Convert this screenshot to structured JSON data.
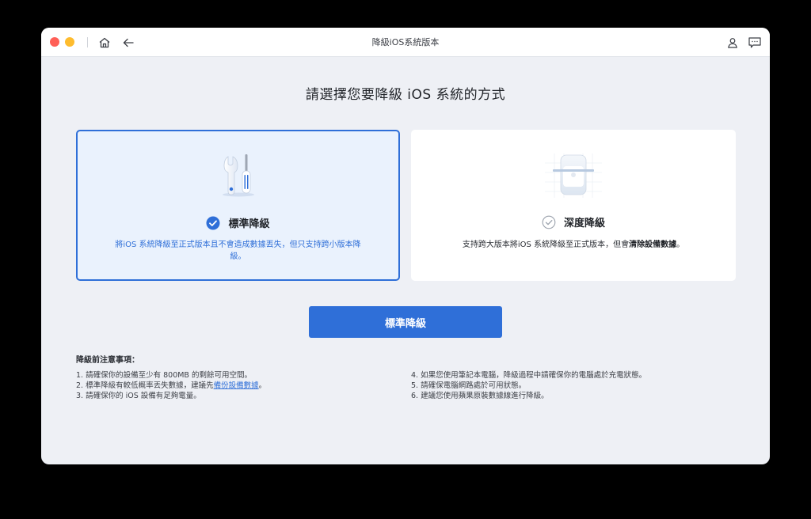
{
  "window": {
    "title": "降級iOS系統版本"
  },
  "main": {
    "heading": "請選擇您要降級 iOS 系統的方式",
    "primary_button": "標準降級"
  },
  "options": [
    {
      "label": "標準降級",
      "selected": true,
      "icon": "tools-icon",
      "desc": "將iOS 系統降級至正式版本且不會造成數據丟失，但只支持跨小版本降級。"
    },
    {
      "label": "深度降級",
      "selected": false,
      "icon": "device-reset-icon",
      "desc_prefix": "支持跨大版本將iOS 系統降級至正式版本，但會",
      "desc_bold": "清除設備數據",
      "desc_suffix": "。"
    }
  ],
  "notes": {
    "title": "降級前注意事項：",
    "item1": "1. 請確保你的設備至少有 800MB 的剩餘可用空間。",
    "item2_prefix": "2. 標準降級有較低概率丟失數據，建議先",
    "item2_link": "備份設備數據",
    "item2_suffix": "。",
    "item3": "3. 請確保你的 iOS 設備有足夠電量。",
    "item4": "4. 如果您使用筆記本電腦，降級過程中請確保你的電腦處於充電狀態。",
    "item5": "5. 請確保電腦網路處於可用狀態。",
    "item6": "6. 建議您使用蘋果原裝數據線進行降級。"
  },
  "colors": {
    "accent": "#2f6fd8",
    "window_bg": "#eef0f5",
    "selected_card_bg": "#eaf2fd"
  }
}
